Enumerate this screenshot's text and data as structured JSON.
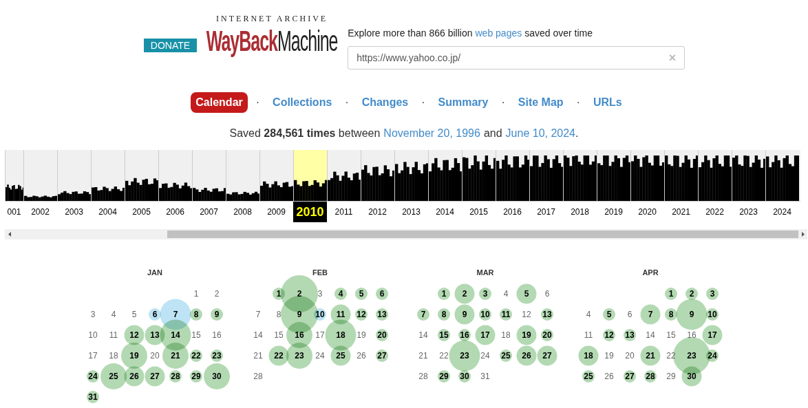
{
  "donate": "DONATE",
  "logo": {
    "top": "INTERNET ARCHIVE",
    "left": "WayBack",
    "right": "Machine"
  },
  "tagline": {
    "before": "Explore more than 866 billion",
    "link": "web pages",
    "after": "saved over time"
  },
  "search": {
    "value": "https://www.yahoo.co.jp/",
    "clear": "×"
  },
  "nav": {
    "separator": "·",
    "items": [
      {
        "label": "Calendar",
        "selected": true
      },
      {
        "label": "Collections",
        "selected": false
      },
      {
        "label": "Changes",
        "selected": false
      },
      {
        "label": "Summary",
        "selected": false
      },
      {
        "label": "Site Map",
        "selected": false
      },
      {
        "label": "URLs",
        "selected": false
      }
    ]
  },
  "saved": {
    "prefix": "Saved **284,561 times** between",
    "start": "November 20, 1996",
    "middle": "and",
    "end": "June 10, 2024",
    "suffix": "."
  },
  "timeline": {
    "years": [
      {
        "label": "001",
        "selected": false
      },
      {
        "label": "2002",
        "selected": false
      },
      {
        "label": "2003",
        "selected": false
      },
      {
        "label": "2004",
        "selected": false
      },
      {
        "label": "2005",
        "selected": false
      },
      {
        "label": "2006",
        "selected": false
      },
      {
        "label": "2007",
        "selected": false
      },
      {
        "label": "2008",
        "selected": false
      },
      {
        "label": "2009",
        "selected": false
      },
      {
        "label": "2010",
        "selected": true
      },
      {
        "label": "2011",
        "selected": false
      },
      {
        "label": "2012",
        "selected": false
      },
      {
        "label": "2013",
        "selected": false
      },
      {
        "label": "2014",
        "selected": false
      },
      {
        "label": "2015",
        "selected": false
      },
      {
        "label": "2016",
        "selected": false
      },
      {
        "label": "2017",
        "selected": false
      },
      {
        "label": "2018",
        "selected": false
      },
      {
        "label": "2019",
        "selected": false
      },
      {
        "label": "2020",
        "selected": false
      },
      {
        "label": "2021",
        "selected": false
      },
      {
        "label": "2022",
        "selected": false
      },
      {
        "label": "2023",
        "selected": false
      },
      {
        "label": "2024",
        "selected": false
      }
    ]
  },
  "months": [
    {
      "name": "JAN",
      "days": [
        {
          "day": "1"
        },
        {
          "day": "2"
        },
        {
          "day": "3"
        },
        {
          "day": "4"
        },
        {
          "day": "5"
        },
        {
          "day": "6",
          "kind": "s",
          "color": "#bde3f5"
        },
        {
          "day": "7",
          "kind": "xl",
          "color": "#bde3f5"
        },
        {
          "day": "8",
          "kind": "s",
          "color": "#b3d9b3"
        },
        {
          "day": "9",
          "kind": "s",
          "color": "#b3d9b3"
        },
        {
          "day": "10"
        },
        {
          "day": "11"
        },
        {
          "day": "12",
          "kind": "m",
          "color": "#b3d9b3"
        },
        {
          "day": "13",
          "kind": "m",
          "color": "#b3d9b3"
        },
        {
          "day": "14",
          "kind": "xl",
          "color": "#b3d9b3"
        },
        {
          "day": "15"
        },
        {
          "day": "16"
        },
        {
          "day": "17"
        },
        {
          "day": "18"
        },
        {
          "day": "19",
          "kind": "l",
          "color": "#b3d9b3"
        },
        {
          "day": "20"
        },
        {
          "day": "21",
          "kind": "l",
          "color": "#b3d9b3"
        },
        {
          "day": "22",
          "kind": "s",
          "color": "#b3d9b3"
        },
        {
          "day": "23",
          "kind": "s",
          "color": "#b3d9b3"
        },
        {
          "day": "24",
          "kind": "s",
          "color": "#b3d9b3"
        },
        {
          "day": "25",
          "kind": "l",
          "color": "#b3d9b3"
        },
        {
          "day": "26",
          "kind": "m",
          "color": "#b3d9b3"
        },
        {
          "day": "27",
          "kind": "m",
          "color": "#b3d9b3"
        },
        {
          "day": "28",
          "kind": "s",
          "color": "#b3d9b3"
        },
        {
          "day": "29",
          "kind": "s",
          "color": "#b3d9b3"
        },
        {
          "day": "30",
          "kind": "l",
          "color": "#b3d9b3"
        },
        {
          "day": "31",
          "kind": "s",
          "color": "#b3d9b3"
        }
      ]
    },
    {
      "name": "FEB",
      "days": [
        {
          "day": "1",
          "kind": "s",
          "color": "#b3d9b3"
        },
        {
          "day": "2",
          "kind": "xxl",
          "color": "#b3d9b3"
        },
        {
          "day": "3"
        },
        {
          "day": "4",
          "kind": "s",
          "color": "#b3d9b3"
        },
        {
          "day": "5",
          "kind": "s",
          "color": "#b3d9b3"
        },
        {
          "day": "6",
          "kind": "s",
          "color": "#b3d9b3"
        },
        {
          "day": "7"
        },
        {
          "day": "8"
        },
        {
          "day": "9",
          "kind": "xxl",
          "color": "#b3d9b3"
        },
        {
          "day": "10",
          "kind": "s",
          "color": "#bde3f5"
        },
        {
          "day": "11",
          "kind": "m",
          "color": "#b3d9b3"
        },
        {
          "day": "12",
          "kind": "s",
          "color": "#b3d9b3"
        },
        {
          "day": "13",
          "kind": "s",
          "color": "#b3d9b3"
        },
        {
          "day": "14"
        },
        {
          "day": "15"
        },
        {
          "day": "16",
          "kind": "l",
          "color": "#b3d9b3"
        },
        {
          "day": "17"
        },
        {
          "day": "18",
          "kind": "xl",
          "color": "#b3d9b3"
        },
        {
          "day": "19"
        },
        {
          "day": "20",
          "kind": "s",
          "color": "#b3d9b3"
        },
        {
          "day": "21"
        },
        {
          "day": "22",
          "kind": "m",
          "color": "#b3d9b3"
        },
        {
          "day": "23",
          "kind": "l",
          "color": "#b3d9b3"
        },
        {
          "day": "24"
        },
        {
          "day": "25",
          "kind": "m",
          "color": "#b3d9b3"
        },
        {
          "day": "26"
        },
        {
          "day": "27",
          "kind": "s",
          "color": "#b3d9b3"
        },
        {
          "day": "28"
        }
      ]
    },
    {
      "name": "MAR",
      "days": [
        {
          "day": "1",
          "kind": "s",
          "color": "#b3d9b3"
        },
        {
          "day": "2",
          "kind": "m",
          "color": "#b3d9b3"
        },
        {
          "day": "3",
          "kind": "s",
          "color": "#b3d9b3"
        },
        {
          "day": "4"
        },
        {
          "day": "5",
          "kind": "m",
          "color": "#b3d9b3"
        },
        {
          "day": "6"
        },
        {
          "day": "7",
          "kind": "s",
          "color": "#b3d9b3"
        },
        {
          "day": "8",
          "kind": "s",
          "color": "#b3d9b3"
        },
        {
          "day": "9",
          "kind": "m",
          "color": "#b3d9b3"
        },
        {
          "day": "10",
          "kind": "s",
          "color": "#b3d9b3"
        },
        {
          "day": "11",
          "kind": "s",
          "color": "#b3d9b3"
        },
        {
          "day": "12"
        },
        {
          "day": "13",
          "kind": "s",
          "color": "#b3d9b3"
        },
        {
          "day": "14"
        },
        {
          "day": "15",
          "kind": "s",
          "color": "#b3d9b3"
        },
        {
          "day": "16",
          "kind": "s",
          "color": "#b3d9b3"
        },
        {
          "day": "17",
          "kind": "m",
          "color": "#b3d9b3"
        },
        {
          "day": "18"
        },
        {
          "day": "19",
          "kind": "m",
          "color": "#b3d9b3"
        },
        {
          "day": "20",
          "kind": "s",
          "color": "#b3d9b3"
        },
        {
          "day": "21"
        },
        {
          "day": "22"
        },
        {
          "day": "23",
          "kind": "xl",
          "color": "#b3d9b3"
        },
        {
          "day": "24"
        },
        {
          "day": "25",
          "kind": "s",
          "color": "#b3d9b3"
        },
        {
          "day": "26",
          "kind": "m",
          "color": "#b3d9b3"
        },
        {
          "day": "27",
          "kind": "m",
          "color": "#b3d9b3"
        },
        {
          "day": "28"
        },
        {
          "day": "29",
          "kind": "s",
          "color": "#b3d9b3"
        },
        {
          "day": "30",
          "kind": "s",
          "color": "#b3d9b3"
        },
        {
          "day": "31"
        }
      ]
    },
    {
      "name": "APR",
      "days": [
        {
          "day": "1",
          "kind": "s",
          "color": "#b3d9b3"
        },
        {
          "day": "2",
          "kind": "s",
          "color": "#b3d9b3"
        },
        {
          "day": "3",
          "kind": "s",
          "color": "#b3d9b3"
        },
        {
          "day": "4"
        },
        {
          "day": "5",
          "kind": "s",
          "color": "#b3d9b3"
        },
        {
          "day": "6"
        },
        {
          "day": "7",
          "kind": "m",
          "color": "#b3d9b3"
        },
        {
          "day": "8",
          "kind": "s",
          "color": "#b3d9b3"
        },
        {
          "day": "9",
          "kind": "xl",
          "color": "#b3d9b3"
        },
        {
          "day": "10",
          "kind": "s",
          "color": "#b3d9b3"
        },
        {
          "day": "11"
        },
        {
          "day": "12",
          "kind": "s",
          "color": "#b3d9b3"
        },
        {
          "day": "13",
          "kind": "s",
          "color": "#b3d9b3"
        },
        {
          "day": "14"
        },
        {
          "day": "15"
        },
        {
          "day": "16"
        },
        {
          "day": "17",
          "kind": "m",
          "color": "#b3d9b3"
        },
        {
          "day": "18",
          "kind": "m",
          "color": "#b3d9b3"
        },
        {
          "day": "19"
        },
        {
          "day": "20"
        },
        {
          "day": "21",
          "kind": "m",
          "color": "#b3d9b3"
        },
        {
          "day": "22"
        },
        {
          "day": "23",
          "kind": "xxl",
          "color": "#b3d9b3"
        },
        {
          "day": "24",
          "kind": "s",
          "color": "#b3d9b3"
        },
        {
          "day": "25",
          "kind": "s",
          "color": "#b3d9b3"
        },
        {
          "day": "26"
        },
        {
          "day": "27",
          "kind": "s",
          "color": "#b3d9b3"
        },
        {
          "day": "28",
          "kind": "s",
          "color": "#b3d9b3"
        },
        {
          "day": "29"
        },
        {
          "day": "30",
          "kind": "m",
          "color": "#b3d9b3"
        }
      ]
    }
  ]
}
